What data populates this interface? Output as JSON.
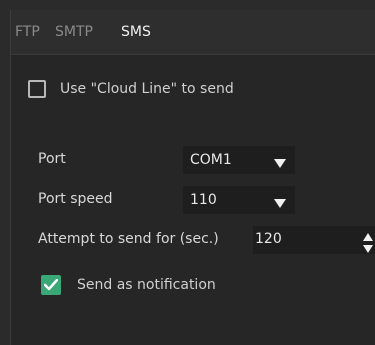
{
  "tabs": [
    {
      "label": "FTP",
      "active": false
    },
    {
      "label": "SMTP",
      "active": false
    },
    {
      "label": "SMS",
      "active": true
    }
  ],
  "cloud_line": {
    "label": "Use \"Cloud Line\" to send",
    "checked": false
  },
  "port": {
    "label": "Port",
    "value": "COM1"
  },
  "port_speed": {
    "label": "Port speed",
    "value": "110"
  },
  "attempt": {
    "label": "Attempt to send for (sec.)",
    "value": "120"
  },
  "notification": {
    "label": "Send as notification",
    "checked": true
  },
  "colors": {
    "accent": "#3aa876",
    "background": "#262626",
    "field": "#1e1e1e"
  }
}
